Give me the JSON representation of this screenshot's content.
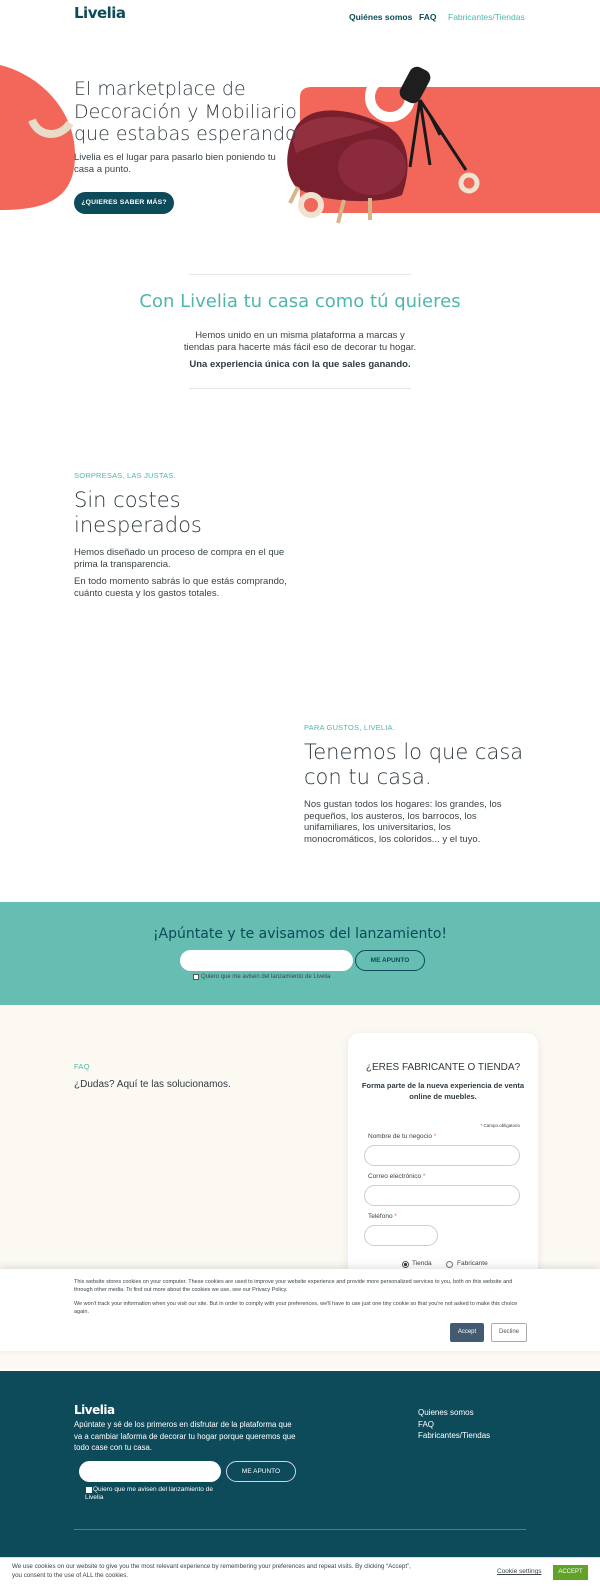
{
  "header": {
    "logo": "Livelia",
    "nav": [
      "Quiénes somos",
      "FAQ",
      "Fabricantes/Tiendas"
    ]
  },
  "hero": {
    "title": "El marketplace de Decoración y Mobiliario que estabas esperando",
    "subtitle": "Livelia es el lugar para pasarlo bien poniendo tu casa a punto.",
    "cta": "¿QUIERES SABER MÁS?"
  },
  "intro": {
    "title": "Con Livelia tu casa como tú quieres",
    "text": "Hemos unido en un misma plataforma a marcas y tiendas para hacerte más fácil eso de decorar tu hogar.",
    "strong": "Una experiencia única con la que sales ganando."
  },
  "feature1": {
    "kicker": "SORPRESAS, LAS JUSTAS.",
    "title": "Sin costes inesperados",
    "p1": "Hemos diseñado un proceso de compra en el que prima la transparencia.",
    "p2": "En todo momento sabrás lo que estás comprando, cuánto cuesta y los gastos totales."
  },
  "feature2": {
    "kicker": "PARA GUSTOS, LIVELIA.",
    "title": "Tenemos lo que casa con tu casa.",
    "p1": "Nos gustan todos los hogares: los grandes, los pequeños, los austeros, los barrocos, los unifamiliares, los universitarios, los monocromáticos, los coloridos... y el tuyo."
  },
  "newsletter": {
    "title": "¡Apúntate y te avisamos del lanzamiento!",
    "button": "ME APUNTO",
    "consent": "Quiero que me avisen del lanzamiento de Livelia"
  },
  "faq": {
    "kicker": "FAQ",
    "title": "¿Dudas? Aquí te las solucionamos."
  },
  "form": {
    "title": "¿ERES FABRICANTE O TIENDA?",
    "subtitle": "Forma parte de la nueva experiencia de venta online de muebles.",
    "required_note": "* Campo obligatorio",
    "business_label": "Nombre de tu negocio",
    "email_label": "Correo electrónico",
    "phone_label": "Teléfono",
    "asterisk": "*",
    "radio_shop": "Tienda",
    "radio_maker": "Fabricante"
  },
  "cookie_panel": {
    "text1": "This website stores cookies on your computer. These cookies are used to improve your website experience and provide more personalized services to you, both on this website and through other media. To find out more about the cookies we use, see our Privacy Policy.",
    "text2": "We won't track your information when you visit our site. But in order to comply with your preferences, we'll have to use just one tiny cookie so that you're not asked to make this choice again.",
    "accept": "Accept",
    "decline": "Decline"
  },
  "footer": {
    "logo": "Livelia",
    "text": "Apúntate y sé de los primeros en disfrutar de la plataforma que va a cambiar laforma de decorar tu hogar porque queremos que todo case con tu casa.",
    "button": "ME APUNTO",
    "consent": "Quiero que me avisen del lanzamiento de Livelia",
    "links": [
      "Quienes somos",
      "FAQ",
      "Fabricantes/Tiendas"
    ]
  },
  "cookie_bar": {
    "text": "We use cookies on our website to give you the most relevant experience by remembering your preferences and repeat visits. By clicking “Accept”, you consent to the use of ALL the cookies.",
    "settings": "Cookie settings",
    "accept": "ACCEPT"
  },
  "colors": {
    "brand": "#0d4a5a",
    "teal": "#4fb6ad",
    "coral": "#f2675a",
    "band": "#66beb3"
  }
}
